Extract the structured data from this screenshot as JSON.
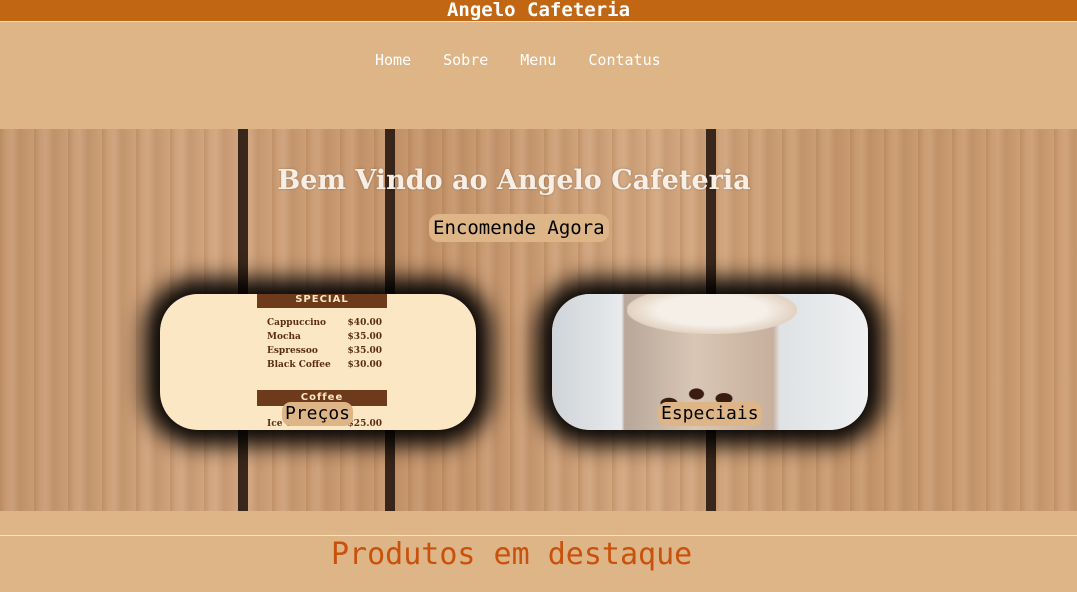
{
  "header": {
    "title": "Angelo Cafeteria"
  },
  "nav": {
    "items": [
      "Home",
      "Sobre",
      "Menu",
      "Contatus"
    ]
  },
  "hero": {
    "title": "Bem Vindo ao Angelo Cafeteria",
    "cta": "Encomende Agora"
  },
  "cards": {
    "prices": {
      "label": "Preços",
      "banner_top": "SPECIAL",
      "rows": [
        {
          "name": "Cappuccino",
          "price": "$40.00"
        },
        {
          "name": "Mocha",
          "price": "$35.00"
        },
        {
          "name": "Espressoo",
          "price": "$35.00"
        },
        {
          "name": "Black Coffee",
          "price": "$30.00"
        }
      ],
      "banner_bottom": "Coffee",
      "partial_row": {
        "name": "Ice C",
        "price": "$25.00"
      }
    },
    "specials": {
      "label": "Especiais"
    }
  },
  "featured": {
    "title": "Produtos em destaque"
  },
  "colors": {
    "topbar": "#c16713",
    "background": "#deb587",
    "featured_title": "#c8510c"
  }
}
